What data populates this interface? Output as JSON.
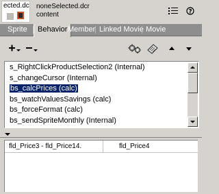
{
  "header": {
    "thumbnail_text": "ected.dc",
    "member_name": "noneSelected.dcr",
    "member_subtitle": "content"
  },
  "tabs": [
    {
      "label": "Sprite",
      "active": false
    },
    {
      "label": "Behavior",
      "active": true
    },
    {
      "label": "Member",
      "active": false
    },
    {
      "label": "Linked Movie",
      "active": false
    },
    {
      "label": "Movie",
      "active": false
    }
  ],
  "behaviors": [
    {
      "label": "s_RightClickProductSelection2 (Internal)",
      "selected": false
    },
    {
      "label": "s_changeCursor (Internal)",
      "selected": false
    },
    {
      "label": "bs_calcPrices (calc)",
      "selected": true
    },
    {
      "label": "bs_watchValuesSavings (calc)",
      "selected": false
    },
    {
      "label": "bs_forceFormat (calc)",
      "selected": false
    },
    {
      "label": "bs_sendSpriteMonthly (Internal)",
      "selected": false
    }
  ],
  "parameters": {
    "name": "fld_Price3 - fld_Price14.",
    "value": "fld_Price4"
  },
  "colors": {
    "panel_bg": "#d6d3ce",
    "tab_bar": "#8e8e8e",
    "selection": "#0a246a"
  }
}
